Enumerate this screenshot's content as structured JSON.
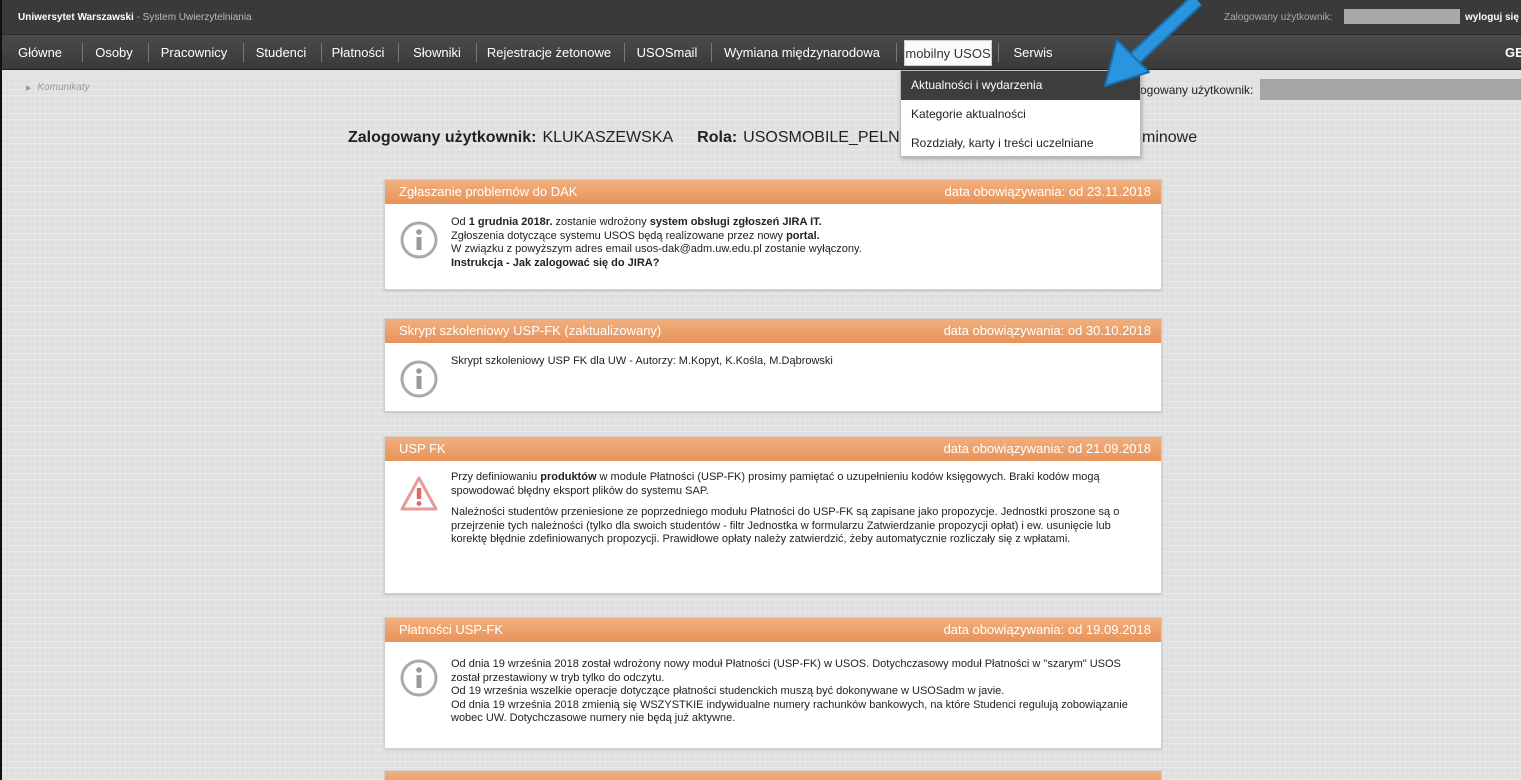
{
  "topbar": {
    "institution": "Uniwersytet Warszawski",
    "system": " - System Uwierzytelniania",
    "logged_label": "Zalogowany użytkownik:",
    "logout": "wyloguj się"
  },
  "nav": {
    "items": [
      "Główne",
      "Osoby",
      "Pracownicy",
      "Studenci",
      "Płatności",
      "Słowniki",
      "Rejestracje żetonowe",
      "USOSmail",
      "Wymiana międzynarodowa",
      "mobilny USOS",
      "Serwis"
    ],
    "right": "GE"
  },
  "breadcrumb": "Komunikaty",
  "right_user_label": "ogowany użytkownik:",
  "heading": {
    "user_label": "Zalogowany użytkownik:",
    "user_value": "KLUKASZEWSKA",
    "role_label": "Rola:",
    "role_value": "USOSMOBILE_PELNA",
    "tail": "minowe"
  },
  "dropdown": {
    "items": [
      "Aktualności i wydarzenia",
      "Kategorie aktualności",
      "Rozdziały, karty i treści uczelniane"
    ]
  },
  "colors": {
    "card_header": "#e8935a",
    "arrow": "#1e8fd8"
  },
  "cards": [
    {
      "title": "Zgłaszanie problemów do DAK",
      "date": "data obowiązywania: od 23.11.2018",
      "icon": "info-icon",
      "l1a": "Od ",
      "l1b": "1 grudnia 2018r.",
      "l1c": " zostanie wdrożony ",
      "l1d": "system obsługi zgłoszeń JIRA IT.",
      "l2a": "Zgłoszenia dotyczące systemu USOS będą realizowane przez nowy ",
      "l2b": "portal.",
      "l3": "W związku z powyższym adres email usos-dak@adm.uw.edu.pl zostanie wyłączony.",
      "l4": "Instrukcja - Jak zalogować się do JIRA?"
    },
    {
      "title": "Skrypt szkoleniowy USP-FK (zaktualizowany)",
      "date": "data obowiązywania: od 30.10.2018",
      "icon": "info-icon",
      "l1": "Skrypt szkoleniowy USP FK dla UW - Autorzy: M.Kopyt, K.Kośla, M.Dąbrowski"
    },
    {
      "title": "USP FK",
      "date": "data obowiązywania: od 21.09.2018",
      "icon": "warning-icon",
      "p1a": "Przy definiowaniu ",
      "p1b": "produktów",
      "p1c": " w module Płatności (USP-FK) prosimy pamiętać o uzupełnieniu kodów księgowych. Braki kodów mogą spowodować błędny eksport plików do systemu SAP.",
      "p2": "Należności studentów przeniesione ze poprzedniego modułu Płatności do USP-FK są zapisane jako propozycje. Jednostki proszone są o przejrzenie tych należności (tylko dla swoich studentów - filtr Jednostka w formularzu Zatwierdzanie propozycji opłat) i ew. usunięcie lub korektę błędnie zdefiniowanych propozycji. Prawidłowe opłaty należy zatwierdzić, żeby automatycznie rozliczały się z wpłatami."
    },
    {
      "title": "Płatności USP-FK",
      "date": "data obowiązywania: od 19.09.2018",
      "icon": "info-icon",
      "l1": "Od dnia 19 września 2018 został wdrożony nowy moduł Płatności (USP-FK) w USOS. Dotychczasowy moduł Płatności w \"szarym\" USOS został przestawiony w tryb tylko do odczytu.",
      "l2": "Od 19 września wszelkie operacje dotyczące płatności studenckich muszą być dokonywane w USOSadm w javie.",
      "l3": "Od dnia 19 września 2018 zmienią się WSZYSTKIE indywidualne numery rachunków bankowych, na które Studenci regulują zobowiązanie wobec UW. Dotychczasowe numery nie będą już aktywne."
    }
  ]
}
